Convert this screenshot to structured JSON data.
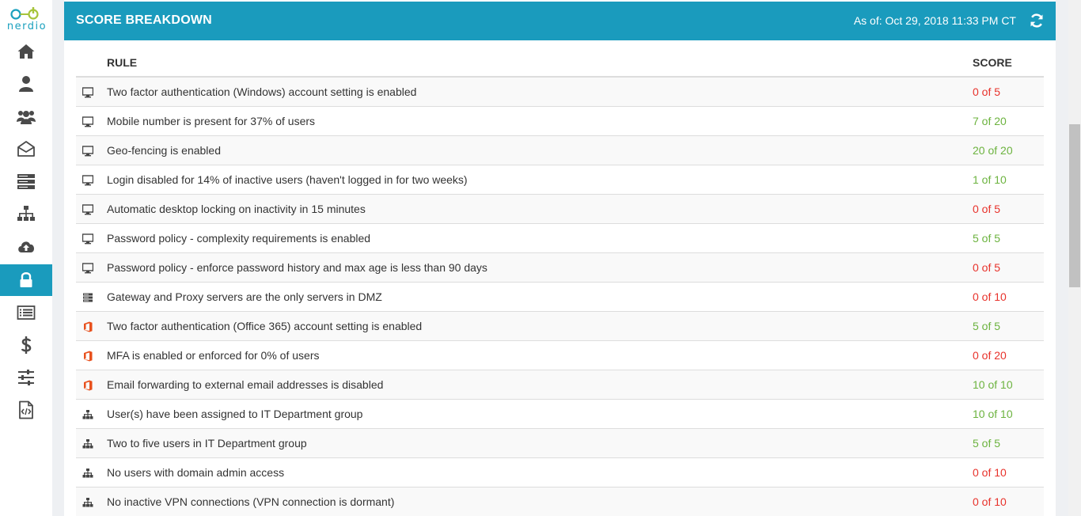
{
  "brand": {
    "name": "nerdio",
    "accent": "#1a9bbd",
    "logo_green": "#a6c43a"
  },
  "sidebar": {
    "items": [
      {
        "icon": "home-icon"
      },
      {
        "icon": "user-icon"
      },
      {
        "icon": "users-icon"
      },
      {
        "icon": "envelope-open-icon"
      },
      {
        "icon": "server-icon"
      },
      {
        "icon": "sitemap-icon"
      },
      {
        "icon": "cloud-upload-icon"
      },
      {
        "icon": "lock-icon",
        "active": true
      },
      {
        "icon": "list-icon"
      },
      {
        "icon": "dollar-icon"
      },
      {
        "icon": "sliders-icon"
      },
      {
        "icon": "code-file-icon"
      }
    ]
  },
  "header": {
    "title": "SCORE BREAKDOWN",
    "as_of": "As of: Oct 29, 2018 11:33 PM CT"
  },
  "table": {
    "columns": {
      "rule": "RULE",
      "score": "SCORE"
    },
    "rows": [
      {
        "icon": "desktop-icon",
        "rule": "Two factor authentication (Windows) account setting is enabled",
        "score": "0 of 5",
        "status": "zero"
      },
      {
        "icon": "desktop-icon",
        "rule": "Mobile number is present for 37% of users",
        "score": "7 of 20",
        "status": "pos"
      },
      {
        "icon": "desktop-icon",
        "rule": "Geo-fencing is enabled",
        "score": "20 of 20",
        "status": "pos"
      },
      {
        "icon": "desktop-icon",
        "rule": "Login disabled for 14% of inactive users (haven't logged in for two weeks)",
        "score": "1 of 10",
        "status": "pos"
      },
      {
        "icon": "desktop-icon",
        "rule": "Automatic desktop locking on inactivity in 15 minutes",
        "score": "0 of 5",
        "status": "zero"
      },
      {
        "icon": "desktop-icon",
        "rule": "Password policy - complexity requirements is enabled",
        "score": "5 of 5",
        "status": "pos"
      },
      {
        "icon": "desktop-icon",
        "rule": "Password policy - enforce password history and max age is less than 90 days",
        "score": "0 of 5",
        "status": "zero"
      },
      {
        "icon": "server-small-icon",
        "rule": "Gateway and Proxy servers are the only servers in DMZ",
        "score": "0 of 10",
        "status": "zero"
      },
      {
        "icon": "office-icon",
        "rule": "Two factor authentication (Office 365) account setting is enabled",
        "score": "5 of 5",
        "status": "pos"
      },
      {
        "icon": "office-icon",
        "rule": "MFA is enabled or enforced for 0% of users",
        "score": "0 of 20",
        "status": "zero"
      },
      {
        "icon": "office-icon",
        "rule": "Email forwarding to external email addresses is disabled",
        "score": "10 of 10",
        "status": "pos"
      },
      {
        "icon": "sitemap-small-icon",
        "rule": "User(s) have been assigned to IT Department group",
        "score": "10 of 10",
        "status": "pos"
      },
      {
        "icon": "sitemap-small-icon",
        "rule": "Two to five users in IT Department group",
        "score": "5 of 5",
        "status": "pos"
      },
      {
        "icon": "sitemap-small-icon",
        "rule": "No users with domain admin access",
        "score": "0 of 10",
        "status": "zero"
      },
      {
        "icon": "sitemap-small-icon",
        "rule": "No inactive VPN connections (VPN connection is dormant)",
        "score": "0 of 10",
        "status": "zero"
      }
    ]
  }
}
